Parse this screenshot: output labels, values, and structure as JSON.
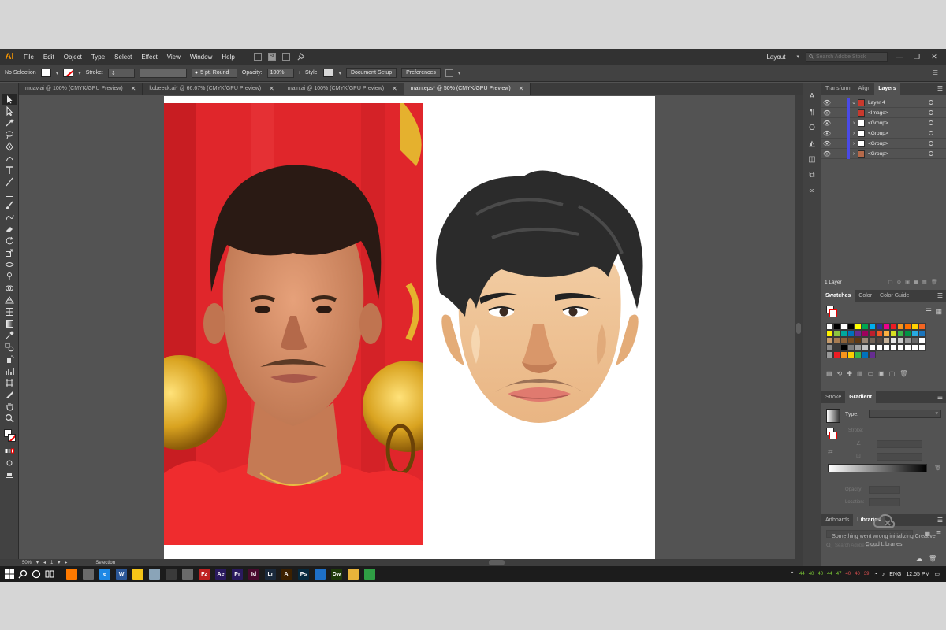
{
  "app": {
    "logo": "Ai",
    "menu": [
      "File",
      "Edit",
      "Object",
      "Type",
      "Select",
      "Effect",
      "View",
      "Window",
      "Help"
    ],
    "workspace": "Layout",
    "search_placeholder": "Search Adobe Stock",
    "window_controls": [
      "—",
      "❐",
      "✕"
    ]
  },
  "control": {
    "selection": "No Selection",
    "stroke_label": "Stroke:",
    "brush": "5 pt. Round",
    "opacity_label": "Opacity:",
    "opacity_value": "100%",
    "style_label": "Style:",
    "doc_setup": "Document Setup",
    "preferences": "Preferences"
  },
  "tabs": [
    {
      "label": "muav.ai @ 100% (CMYK/GPU Preview)",
      "close": "✕"
    },
    {
      "label": "kobeeck.ai* @ 66.67% (CMYK/GPU Preview)",
      "close": "✕"
    },
    {
      "label": "main.ai @ 100% (CMYK/GPU Preview)",
      "close": "✕"
    },
    {
      "label": "main.eps* @ 50% (CMYK/GPU Preview)",
      "close": "✕",
      "active": true
    }
  ],
  "status": {
    "zoom": "50%",
    "page": "1",
    "mode": "Selection"
  },
  "layers_panel": {
    "tabs": [
      "Transform",
      "Align",
      "Layers"
    ],
    "layer_name": "Layer 4",
    "rows": [
      "<Image>",
      "<Group>",
      "<Group>",
      "<Group>",
      "<Group>"
    ],
    "footer": "1 Layer"
  },
  "swatches_panel": {
    "tabs": [
      "Swatches",
      "Color",
      "Color Guide"
    ]
  },
  "gradient_panel": {
    "tabs": [
      "Stroke",
      "Gradient"
    ],
    "type_label": "Type:",
    "stroke_label": "Stroke:",
    "opacity_label": "Opacity:",
    "location_label": "Location:"
  },
  "libraries_panel": {
    "tabs": [
      "Artboards",
      "Libraries"
    ],
    "search_placeholder": "Search Adobe Stock",
    "message": "Something went wrong initializing Creative Cloud Libraries"
  },
  "taskbar": {
    "apps": [
      {
        "label": "",
        "color": "#ff7a00"
      },
      {
        "label": "",
        "color": "#6a6a6a"
      },
      {
        "label": "e",
        "color": "#1e88e5"
      },
      {
        "label": "W",
        "color": "#2b5797"
      },
      {
        "label": "",
        "color": "#f5c518"
      },
      {
        "label": "",
        "color": "#8aa4b8"
      },
      {
        "label": "",
        "color": "#3a3a3a"
      },
      {
        "label": "",
        "color": "#6a6a6a"
      },
      {
        "label": "Fz",
        "color": "#bf2121"
      },
      {
        "label": "Ae",
        "color": "#2a1a5e"
      },
      {
        "label": "Pr",
        "color": "#2a1a5e"
      },
      {
        "label": "Id",
        "color": "#4a0a2e"
      },
      {
        "label": "Lr",
        "color": "#1b2a3c"
      },
      {
        "label": "Ai",
        "color": "#3d2100"
      },
      {
        "label": "Ps",
        "color": "#062a3e"
      },
      {
        "label": "",
        "color": "#1e6fc7"
      },
      {
        "label": "Dw",
        "color": "#1f3a0a"
      },
      {
        "label": "",
        "color": "#e8b33a"
      },
      {
        "label": "",
        "color": "#2f9e44"
      }
    ],
    "network": [
      "44",
      "40",
      "40",
      "44",
      "47",
      "40",
      "40",
      "39"
    ],
    "lang": "ENG",
    "time": "12:55 PM"
  },
  "colors": {
    "accent_orange": "#ff9a00",
    "layer_color": "#4a4ae6",
    "panel_bg": "#535353",
    "chrome_bg": "#323232"
  }
}
